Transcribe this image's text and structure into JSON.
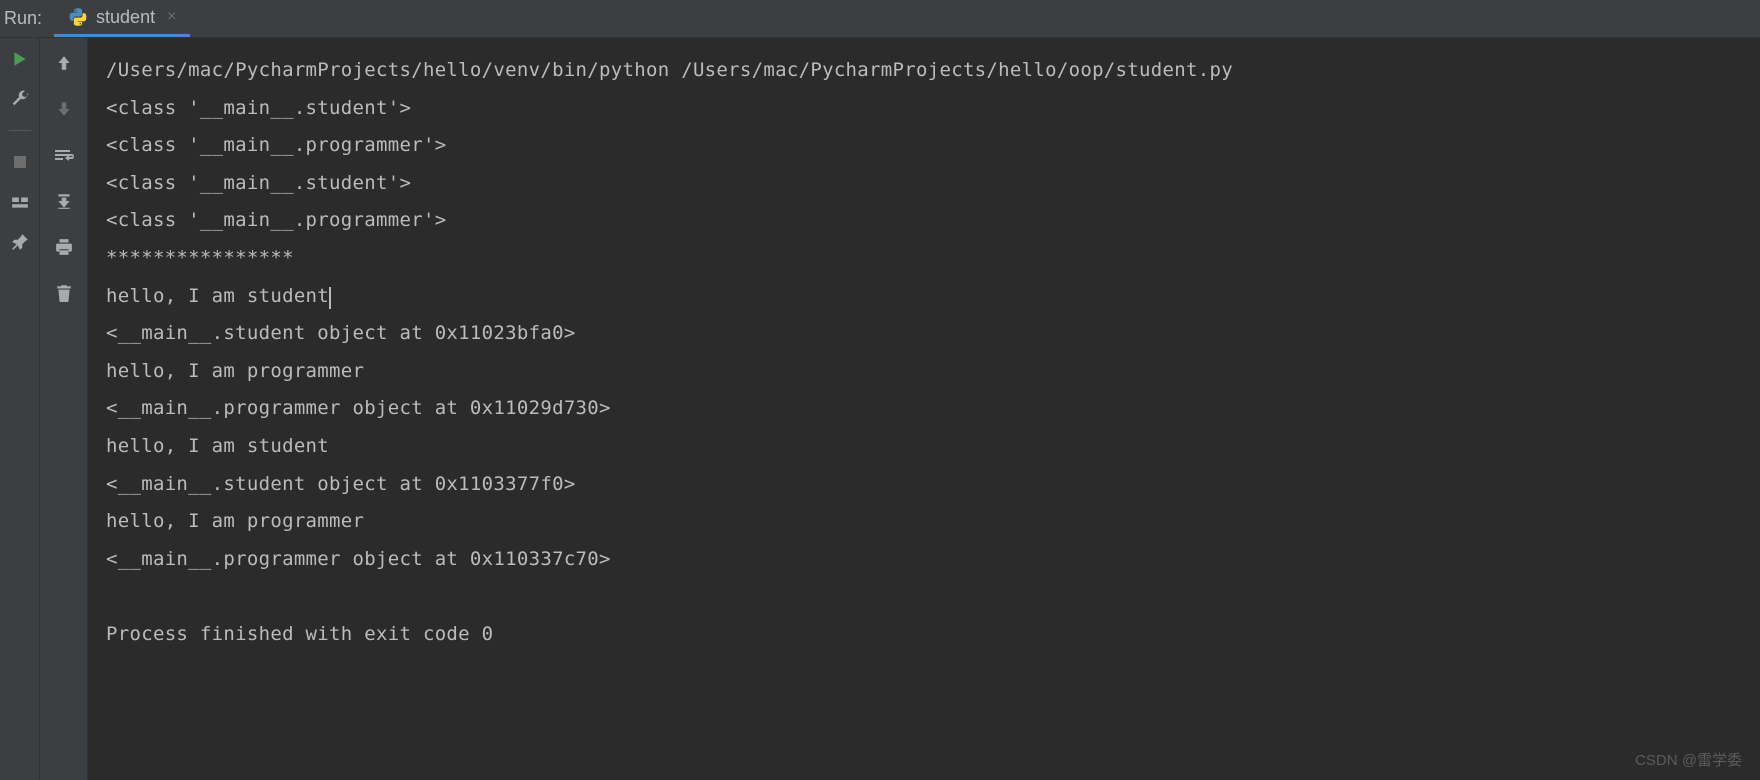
{
  "topbar": {
    "run_label": "Run:",
    "tab": {
      "name": "student",
      "close": "×"
    }
  },
  "toolbar": {
    "run": "run-icon",
    "wrench": "wrench-icon",
    "stop": "stop-icon",
    "layout": "layout-icon",
    "pin": "pin-icon",
    "up": "up-arrow-icon",
    "down": "down-arrow-icon",
    "wrap": "wrap-icon",
    "scroll": "scroll-to-end-icon",
    "print": "print-icon",
    "trash": "trash-icon"
  },
  "console": {
    "lines": [
      "/Users/mac/PycharmProjects/hello/venv/bin/python /Users/mac/PycharmProjects/hello/oop/student.py",
      "<class '__main__.student'>",
      "<class '__main__.programmer'>",
      "<class '__main__.student'>",
      "<class '__main__.programmer'>",
      "****************",
      "hello, I am student",
      "<__main__.student object at 0x11023bfa0>",
      "hello, I am programmer",
      "<__main__.programmer object at 0x11029d730>",
      "hello, I am student",
      "<__main__.student object at 0x1103377f0>",
      "hello, I am programmer",
      "<__main__.programmer object at 0x110337c70>",
      "",
      "Process finished with exit code 0"
    ],
    "cursor_line_index": 6
  },
  "watermark": "CSDN @雷学委"
}
